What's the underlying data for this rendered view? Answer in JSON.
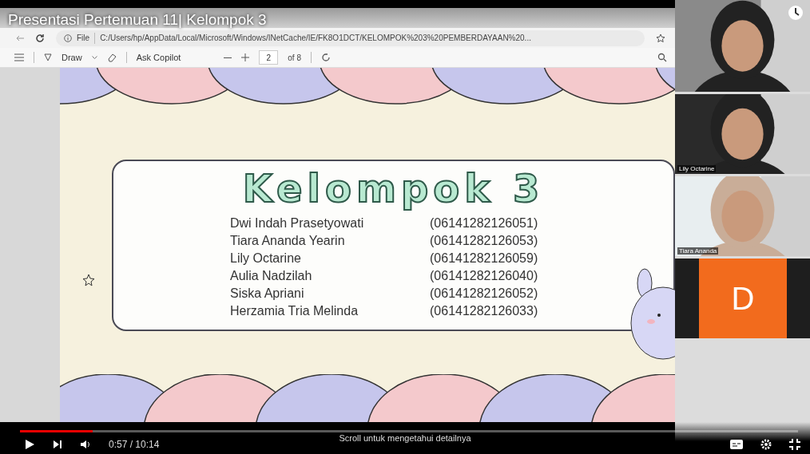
{
  "player": {
    "title": "Presentasi Pertemuan 11| Kelompok 3",
    "time": "0:57 / 10:14",
    "progress": {
      "level": 0.093
    },
    "hint": "Scroll untuk mengetahui detailnya"
  },
  "browser": {
    "address_label": "File",
    "address": "C:/Users/hp/AppData/Local/Microsoft/Windows/INetCache/IE/FK8O1DCT/KELOMPOK%203%20PEMBERDAYAAN%20...",
    "draw": "Draw",
    "copilot": "Ask Copilot",
    "page": "2",
    "page_total": "of 8"
  },
  "slide": {
    "title": "Kelompok 3",
    "members": [
      {
        "name": "Dwi Indah Prasetyowati",
        "id": "(06141282126051)"
      },
      {
        "name": "Tiara Ananda Yearin",
        "id": "(06141282126053)"
      },
      {
        "name": "Lily Octarine",
        "id": "(06141282126059)"
      },
      {
        "name": "Aulia Nadzilah",
        "id": "(06141282126040)"
      },
      {
        "name": "Siska Apriani",
        "id": "(06141282126052)"
      },
      {
        "name": "Herzamia Tria Melinda",
        "id": "(06141282126033)"
      }
    ]
  },
  "participants": [
    {
      "kind": "video"
    },
    {
      "kind": "video",
      "name": "Lily Octarine"
    },
    {
      "kind": "video",
      "name": "Tiara Ananda"
    },
    {
      "kind": "avatar",
      "initial": "D"
    }
  ]
}
